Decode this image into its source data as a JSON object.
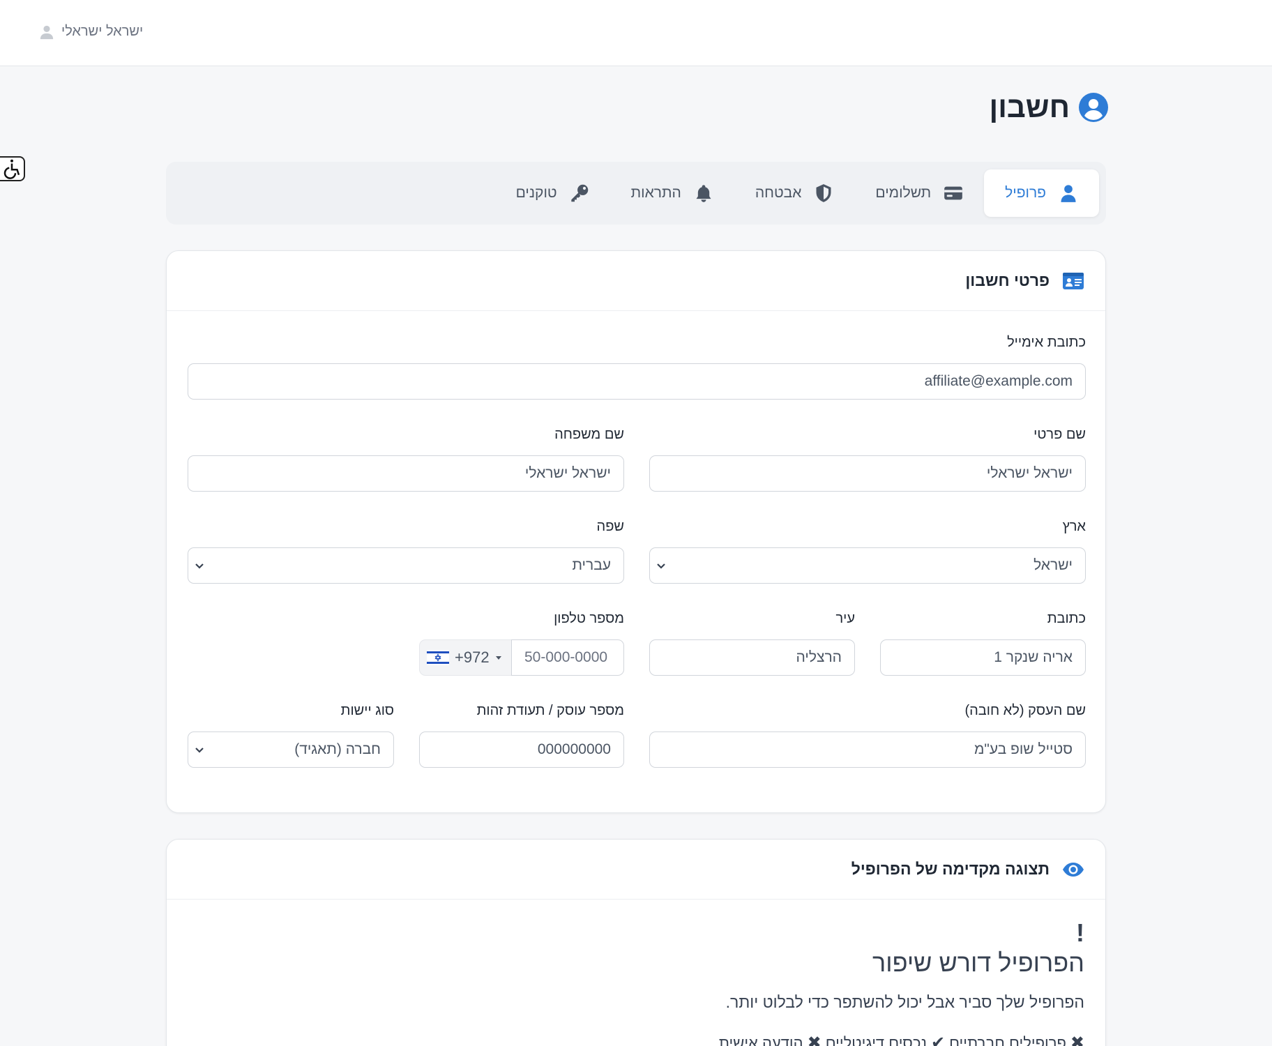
{
  "topbar": {
    "user_name": "ישראל ישראלי"
  },
  "page": {
    "title": "חשבון"
  },
  "tabs": [
    {
      "label": "פרופיל",
      "icon": "user-icon",
      "active": true
    },
    {
      "label": "תשלומים",
      "icon": "credit-card-icon",
      "active": false
    },
    {
      "label": "אבטחה",
      "icon": "shield-icon",
      "active": false
    },
    {
      "label": "התראות",
      "icon": "bell-icon",
      "active": false
    },
    {
      "label": "טוקנים",
      "icon": "key-icon",
      "active": false
    }
  ],
  "account_card": {
    "title": "פרטי חשבון",
    "email": {
      "label": "כתובת אימייל",
      "value": "affiliate@example.com"
    },
    "first_name": {
      "label": "שם פרטי",
      "value": "ישראל ישראלי"
    },
    "last_name": {
      "label": "שם משפחה",
      "value": "ישראל ישראלי"
    },
    "country": {
      "label": "ארץ",
      "value": "ישראל"
    },
    "language": {
      "label": "שפה",
      "value": "עברית"
    },
    "address": {
      "label": "כתובת",
      "value": "אריה שנקר 1"
    },
    "city": {
      "label": "עיר",
      "value": "הרצליה"
    },
    "phone": {
      "label": "מספר טלפון",
      "country_code": "+972",
      "placeholder": "50-000-0000"
    },
    "business_name": {
      "label": "שם העסק (לא חובה)",
      "value": "סטייל שופ בע\"מ"
    },
    "business_id": {
      "label": "מספר עוסק / תעודת זהות",
      "value": "000000000"
    },
    "entity_type": {
      "label": "סוג יישות",
      "value": "חברה (תאגיד)"
    }
  },
  "preview_card": {
    "title": "תצוגה מקדימה של הפרופיל",
    "warning_mark": "!",
    "heading": "הפרופיל דורש שיפור",
    "text": "הפרופיל שלך סביר אבל יכול להשתפר כדי לבלוט יותר.",
    "checks": [
      {
        "mark": "✖",
        "label": "פרופילים חברתיים"
      },
      {
        "mark": "✔",
        "label": "נכסים דיגיטליים"
      },
      {
        "mark": "✖",
        "label": "הודעה אישית"
      }
    ]
  },
  "colors": {
    "accent": "#2e7cd6",
    "text": "#1f2733",
    "muted": "#6b7280",
    "background": "#f6f7f9"
  }
}
